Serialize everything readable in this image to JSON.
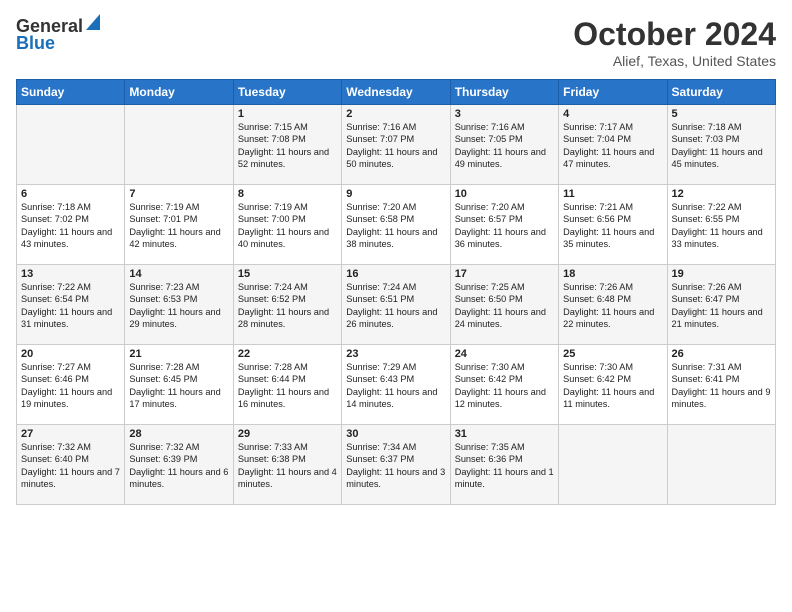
{
  "logo": {
    "line1": "General",
    "line2": "Blue"
  },
  "title": "October 2024",
  "subtitle": "Alief, Texas, United States",
  "headers": [
    "Sunday",
    "Monday",
    "Tuesday",
    "Wednesday",
    "Thursday",
    "Friday",
    "Saturday"
  ],
  "weeks": [
    [
      {
        "day": "",
        "sunrise": "",
        "sunset": "",
        "daylight": ""
      },
      {
        "day": "",
        "sunrise": "",
        "sunset": "",
        "daylight": ""
      },
      {
        "day": "1",
        "sunrise": "Sunrise: 7:15 AM",
        "sunset": "Sunset: 7:08 PM",
        "daylight": "Daylight: 11 hours and 52 minutes."
      },
      {
        "day": "2",
        "sunrise": "Sunrise: 7:16 AM",
        "sunset": "Sunset: 7:07 PM",
        "daylight": "Daylight: 11 hours and 50 minutes."
      },
      {
        "day": "3",
        "sunrise": "Sunrise: 7:16 AM",
        "sunset": "Sunset: 7:05 PM",
        "daylight": "Daylight: 11 hours and 49 minutes."
      },
      {
        "day": "4",
        "sunrise": "Sunrise: 7:17 AM",
        "sunset": "Sunset: 7:04 PM",
        "daylight": "Daylight: 11 hours and 47 minutes."
      },
      {
        "day": "5",
        "sunrise": "Sunrise: 7:18 AM",
        "sunset": "Sunset: 7:03 PM",
        "daylight": "Daylight: 11 hours and 45 minutes."
      }
    ],
    [
      {
        "day": "6",
        "sunrise": "Sunrise: 7:18 AM",
        "sunset": "Sunset: 7:02 PM",
        "daylight": "Daylight: 11 hours and 43 minutes."
      },
      {
        "day": "7",
        "sunrise": "Sunrise: 7:19 AM",
        "sunset": "Sunset: 7:01 PM",
        "daylight": "Daylight: 11 hours and 42 minutes."
      },
      {
        "day": "8",
        "sunrise": "Sunrise: 7:19 AM",
        "sunset": "Sunset: 7:00 PM",
        "daylight": "Daylight: 11 hours and 40 minutes."
      },
      {
        "day": "9",
        "sunrise": "Sunrise: 7:20 AM",
        "sunset": "Sunset: 6:58 PM",
        "daylight": "Daylight: 11 hours and 38 minutes."
      },
      {
        "day": "10",
        "sunrise": "Sunrise: 7:20 AM",
        "sunset": "Sunset: 6:57 PM",
        "daylight": "Daylight: 11 hours and 36 minutes."
      },
      {
        "day": "11",
        "sunrise": "Sunrise: 7:21 AM",
        "sunset": "Sunset: 6:56 PM",
        "daylight": "Daylight: 11 hours and 35 minutes."
      },
      {
        "day": "12",
        "sunrise": "Sunrise: 7:22 AM",
        "sunset": "Sunset: 6:55 PM",
        "daylight": "Daylight: 11 hours and 33 minutes."
      }
    ],
    [
      {
        "day": "13",
        "sunrise": "Sunrise: 7:22 AM",
        "sunset": "Sunset: 6:54 PM",
        "daylight": "Daylight: 11 hours and 31 minutes."
      },
      {
        "day": "14",
        "sunrise": "Sunrise: 7:23 AM",
        "sunset": "Sunset: 6:53 PM",
        "daylight": "Daylight: 11 hours and 29 minutes."
      },
      {
        "day": "15",
        "sunrise": "Sunrise: 7:24 AM",
        "sunset": "Sunset: 6:52 PM",
        "daylight": "Daylight: 11 hours and 28 minutes."
      },
      {
        "day": "16",
        "sunrise": "Sunrise: 7:24 AM",
        "sunset": "Sunset: 6:51 PM",
        "daylight": "Daylight: 11 hours and 26 minutes."
      },
      {
        "day": "17",
        "sunrise": "Sunrise: 7:25 AM",
        "sunset": "Sunset: 6:50 PM",
        "daylight": "Daylight: 11 hours and 24 minutes."
      },
      {
        "day": "18",
        "sunrise": "Sunrise: 7:26 AM",
        "sunset": "Sunset: 6:48 PM",
        "daylight": "Daylight: 11 hours and 22 minutes."
      },
      {
        "day": "19",
        "sunrise": "Sunrise: 7:26 AM",
        "sunset": "Sunset: 6:47 PM",
        "daylight": "Daylight: 11 hours and 21 minutes."
      }
    ],
    [
      {
        "day": "20",
        "sunrise": "Sunrise: 7:27 AM",
        "sunset": "Sunset: 6:46 PM",
        "daylight": "Daylight: 11 hours and 19 minutes."
      },
      {
        "day": "21",
        "sunrise": "Sunrise: 7:28 AM",
        "sunset": "Sunset: 6:45 PM",
        "daylight": "Daylight: 11 hours and 17 minutes."
      },
      {
        "day": "22",
        "sunrise": "Sunrise: 7:28 AM",
        "sunset": "Sunset: 6:44 PM",
        "daylight": "Daylight: 11 hours and 16 minutes."
      },
      {
        "day": "23",
        "sunrise": "Sunrise: 7:29 AM",
        "sunset": "Sunset: 6:43 PM",
        "daylight": "Daylight: 11 hours and 14 minutes."
      },
      {
        "day": "24",
        "sunrise": "Sunrise: 7:30 AM",
        "sunset": "Sunset: 6:42 PM",
        "daylight": "Daylight: 11 hours and 12 minutes."
      },
      {
        "day": "25",
        "sunrise": "Sunrise: 7:30 AM",
        "sunset": "Sunset: 6:42 PM",
        "daylight": "Daylight: 11 hours and 11 minutes."
      },
      {
        "day": "26",
        "sunrise": "Sunrise: 7:31 AM",
        "sunset": "Sunset: 6:41 PM",
        "daylight": "Daylight: 11 hours and 9 minutes."
      }
    ],
    [
      {
        "day": "27",
        "sunrise": "Sunrise: 7:32 AM",
        "sunset": "Sunset: 6:40 PM",
        "daylight": "Daylight: 11 hours and 7 minutes."
      },
      {
        "day": "28",
        "sunrise": "Sunrise: 7:32 AM",
        "sunset": "Sunset: 6:39 PM",
        "daylight": "Daylight: 11 hours and 6 minutes."
      },
      {
        "day": "29",
        "sunrise": "Sunrise: 7:33 AM",
        "sunset": "Sunset: 6:38 PM",
        "daylight": "Daylight: 11 hours and 4 minutes."
      },
      {
        "day": "30",
        "sunrise": "Sunrise: 7:34 AM",
        "sunset": "Sunset: 6:37 PM",
        "daylight": "Daylight: 11 hours and 3 minutes."
      },
      {
        "day": "31",
        "sunrise": "Sunrise: 7:35 AM",
        "sunset": "Sunset: 6:36 PM",
        "daylight": "Daylight: 11 hours and 1 minute."
      },
      {
        "day": "",
        "sunrise": "",
        "sunset": "",
        "daylight": ""
      },
      {
        "day": "",
        "sunrise": "",
        "sunset": "",
        "daylight": ""
      }
    ]
  ]
}
